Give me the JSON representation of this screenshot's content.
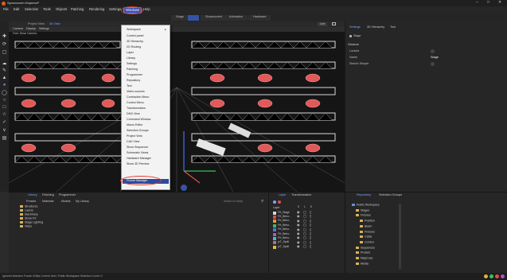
{
  "app": {
    "title": "Syncronorm Depence²"
  },
  "menubar": [
    "File",
    "Edit",
    "Selection",
    "Tools",
    "Objects",
    "Patching",
    "Rendering",
    "Settings",
    "Windows",
    "Help"
  ],
  "modes": {
    "tab1": "Stage",
    "tab2": "Showcontrol",
    "tab3": "Animation",
    "tab4": "Hardware"
  },
  "viewport": {
    "tab_active": "3d View",
    "tab_other": "Project View",
    "sub_items": [
      "Camera",
      "Display",
      "Settings"
    ],
    "camera_label": "Free: Move Camera",
    "top_right": "Live"
  },
  "windows_menu": {
    "items": [
      "Workspace",
      "Control panel",
      "3D Hierarchy",
      "I/O Routing",
      "Layer",
      "Library",
      "Settings",
      "Patching",
      "Programmer",
      "Repository",
      "Text",
      "Video sources",
      "Contraction Menu",
      "Control Menu",
      "Transformation",
      "DMX View",
      "Command Window",
      "Macro Editor",
      "Selection Groups",
      "Project View",
      "CAD View",
      "Show Sequencer",
      "Schematic Views",
      "Hardware Manager",
      "Show 3D Preview",
      "Fixture Manager"
    ],
    "highlighted": "Fixture Manager"
  },
  "properties": {
    "tabs": [
      "Settings",
      "3D Hierarchy",
      "Tool"
    ],
    "header": "Stage",
    "section": "General",
    "rows": [
      {
        "label": "Locked",
        "value": ""
      },
      {
        "label": "Name",
        "value": "Stage"
      },
      {
        "label": "Sketch Simple",
        "value": ""
      }
    ]
  },
  "library": {
    "tabs": [
      "Library",
      "Patching",
      "Programmer"
    ],
    "filters": [
      "Presets",
      "Materials",
      "Models",
      "My Library"
    ],
    "tree": [
      "Structures",
      "Lasers",
      "Machinery",
      "Show FX",
      "Stage Lighting",
      "Video"
    ],
    "search_placeholder": "Search in Library"
  },
  "layers": {
    "tabs": [
      "Layer",
      "Transformation"
    ],
    "column": "Layer",
    "col_flags": [
      "S",
      "L",
      "E"
    ],
    "items": [
      {
        "name": "FH_Stage",
        "color": "#d9d9d9"
      },
      {
        "name": "FH_Beho..",
        "color": "#d94b4b"
      },
      {
        "name": "FH_Beho..",
        "color": "#e09a3a"
      },
      {
        "name": "FH_Beho..",
        "color": "#3fbf5a"
      },
      {
        "name": "FH_Beho..",
        "color": "#4f76d8"
      },
      {
        "name": "FH_Beho..",
        "color": "#b650c9"
      },
      {
        "name": "FH_Beho..",
        "color": "#3fc0c5"
      },
      {
        "name": "yrT_Spriil",
        "color": "#d85b8a"
      },
      {
        "name": "yrT_Spriil",
        "color": "#d3c243"
      }
    ]
  },
  "repository": {
    "tabs": [
      "Repository",
      "Selection Groups"
    ],
    "tree": [
      {
        "name": "Public Workspace",
        "level": 0
      },
      {
        "name": "Stages",
        "level": 1
      },
      {
        "name": "Fixtures",
        "level": 1
      },
      {
        "name": "Position",
        "level": 2
      },
      {
        "name": "Beam",
        "level": 2
      },
      {
        "name": "Fixtures",
        "level": 2
      },
      {
        "name": "Cable",
        "level": 2
      },
      {
        "name": "Control",
        "level": 2
      },
      {
        "name": "Sequences",
        "level": 1
      },
      {
        "name": "Presets",
        "level": 1
      },
      {
        "name": "MapCues",
        "level": 1
      },
      {
        "name": "Media",
        "level": 1
      }
    ]
  },
  "status": {
    "text": "Ignored selection  Found: 0/0fps  Current User: Public Workspace  Selection Count: 0"
  },
  "colors": {
    "accent": "#3553a5",
    "highlight_circle": "#e23a2e",
    "truss": "#d9d9d9",
    "light": "#e05a5a"
  }
}
